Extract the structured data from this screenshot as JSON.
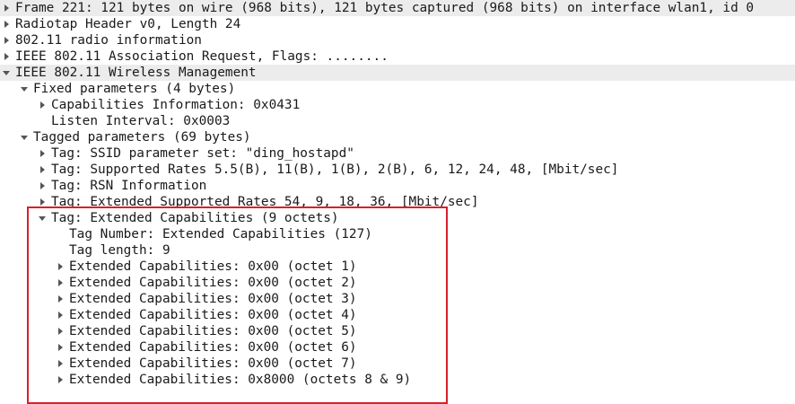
{
  "colors": {
    "row_highlight": "#ececec",
    "expander": "#555555",
    "annotation_box": "#d8202d",
    "text": "#1a1a1a"
  },
  "rows": [
    {
      "label": "Frame 221: 121 bytes on wire (968 bits), 121 bytes captured (968 bits) on interface wlan1, id 0",
      "depth": 0,
      "toggle": "closed",
      "shaded": true
    },
    {
      "label": "Radiotap Header v0, Length 24",
      "depth": 0,
      "toggle": "closed",
      "shaded": false
    },
    {
      "label": "802.11 radio information",
      "depth": 0,
      "toggle": "closed",
      "shaded": false
    },
    {
      "label": "IEEE 802.11 Association Request, Flags: ........",
      "depth": 0,
      "toggle": "closed",
      "shaded": false
    },
    {
      "label": "IEEE 802.11 Wireless Management",
      "depth": 0,
      "toggle": "open",
      "shaded": true
    },
    {
      "label": "Fixed parameters (4 bytes)",
      "depth": 1,
      "toggle": "open",
      "shaded": false
    },
    {
      "label": "Capabilities Information: 0x0431",
      "depth": 2,
      "toggle": "closed",
      "shaded": false
    },
    {
      "label": "Listen Interval: 0x0003",
      "depth": 2,
      "toggle": "none",
      "shaded": false
    },
    {
      "label": "Tagged parameters (69 bytes)",
      "depth": 1,
      "toggle": "open",
      "shaded": false
    },
    {
      "label": "Tag: SSID parameter set: \"ding_hostapd\"",
      "depth": 2,
      "toggle": "closed",
      "shaded": false
    },
    {
      "label": "Tag: Supported Rates 5.5(B), 11(B), 1(B), 2(B), 6, 12, 24, 48, [Mbit/sec]",
      "depth": 2,
      "toggle": "closed",
      "shaded": false
    },
    {
      "label": "Tag: RSN Information",
      "depth": 2,
      "toggle": "closed",
      "shaded": false
    },
    {
      "label": "Tag: Extended Supported Rates 54, 9, 18, 36, [Mbit/sec]",
      "depth": 2,
      "toggle": "closed",
      "shaded": false
    },
    {
      "label": "Tag: Extended Capabilities (9 octets)",
      "depth": 2,
      "toggle": "open",
      "shaded": false
    },
    {
      "label": "Tag Number: Extended Capabilities (127)",
      "depth": 3,
      "toggle": "none",
      "shaded": false
    },
    {
      "label": "Tag length: 9",
      "depth": 3,
      "toggle": "none",
      "shaded": false
    },
    {
      "label": "Extended Capabilities: 0x00 (octet 1)",
      "depth": 3,
      "toggle": "closed",
      "shaded": false
    },
    {
      "label": "Extended Capabilities: 0x00 (octet 2)",
      "depth": 3,
      "toggle": "closed",
      "shaded": false
    },
    {
      "label": "Extended Capabilities: 0x00 (octet 3)",
      "depth": 3,
      "toggle": "closed",
      "shaded": false
    },
    {
      "label": "Extended Capabilities: 0x00 (octet 4)",
      "depth": 3,
      "toggle": "closed",
      "shaded": false
    },
    {
      "label": "Extended Capabilities: 0x00 (octet 5)",
      "depth": 3,
      "toggle": "closed",
      "shaded": false
    },
    {
      "label": "Extended Capabilities: 0x00 (octet 6)",
      "depth": 3,
      "toggle": "closed",
      "shaded": false
    },
    {
      "label": "Extended Capabilities: 0x00 (octet 7)",
      "depth": 3,
      "toggle": "closed",
      "shaded": false
    },
    {
      "label": "Extended Capabilities: 0x8000 (octets 8 & 9)",
      "depth": 3,
      "toggle": "closed",
      "shaded": false
    }
  ]
}
